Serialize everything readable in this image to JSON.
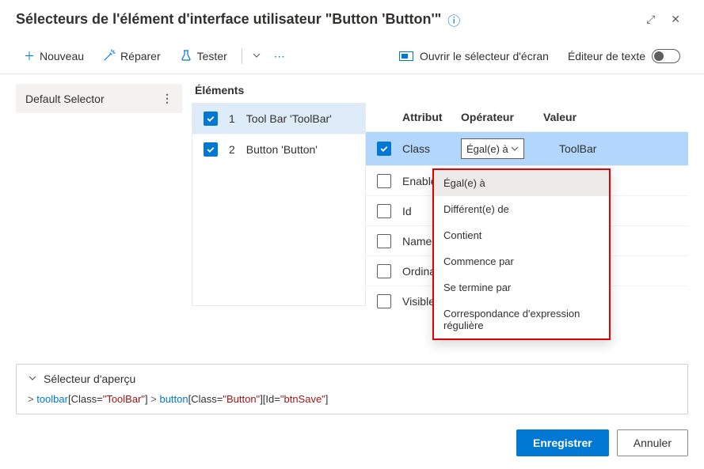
{
  "header": {
    "title": "Sélecteurs de l'élément d'interface utilisateur \"Button 'Button'\""
  },
  "toolbar": {
    "new_label": "Nouveau",
    "repair_label": "Réparer",
    "test_label": "Tester",
    "screen_selector_label": "Ouvrir le sélecteur d'écran",
    "text_editor_label": "Éditeur de texte"
  },
  "sidebar": {
    "items": [
      {
        "label": "Default Selector"
      }
    ]
  },
  "elements": {
    "title": "Éléments",
    "items": [
      {
        "index": "1",
        "label": "Tool Bar 'ToolBar'",
        "checked": true,
        "selected": true
      },
      {
        "index": "2",
        "label": "Button 'Button'",
        "checked": true,
        "selected": false
      }
    ]
  },
  "attributes": {
    "head_attr": "Attribut",
    "head_op": "Opérateur",
    "head_val": "Valeur",
    "rows": [
      {
        "name": "Class",
        "operator": "Égal(e) à",
        "value": "ToolBar",
        "checked": true,
        "active": true
      },
      {
        "name": "Enabled",
        "checked": false
      },
      {
        "name": "Id",
        "checked": false
      },
      {
        "name": "Name",
        "checked": false
      },
      {
        "name": "Ordinal",
        "checked": false
      },
      {
        "name": "Visible",
        "checked": false
      }
    ]
  },
  "operator_dropdown": {
    "options": [
      "Égal(e) à",
      "Différent(e) de",
      "Contient",
      "Commence par",
      "Se termine par",
      "Correspondance d'expression régulière"
    ]
  },
  "preview": {
    "label": "Sélecteur d'aperçu",
    "path": {
      "prefix": "> ",
      "seg1_el": "toolbar",
      "seg1_attr": "Class",
      "seg1_val": "\"ToolBar\"",
      "sep": " > ",
      "seg2_el": "button",
      "seg2_attr1": "Class",
      "seg2_val1": "\"Button\"",
      "seg2_attr2": "Id",
      "seg2_val2": "\"btnSave\""
    }
  },
  "footer": {
    "save": "Enregistrer",
    "cancel": "Annuler"
  }
}
